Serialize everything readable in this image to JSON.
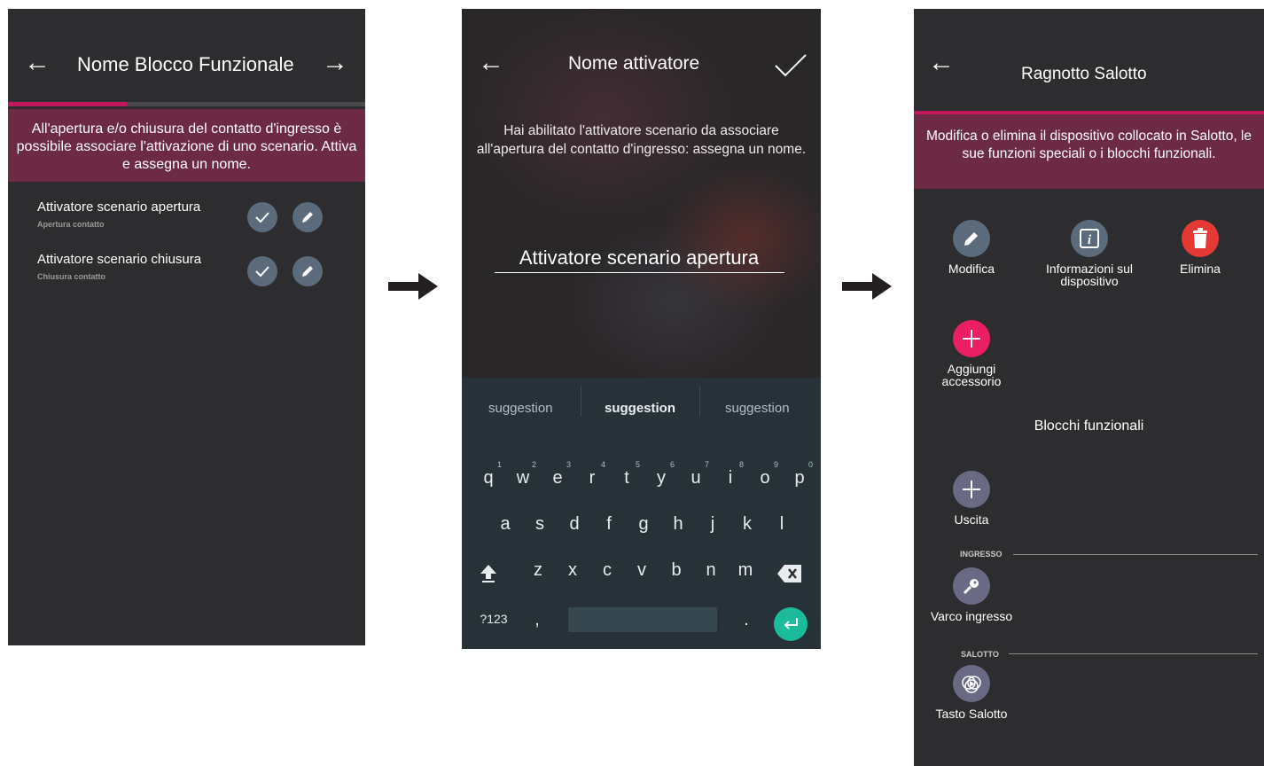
{
  "screen1": {
    "title": "Nome Blocco Funzionale",
    "banner": "All'apertura e/o chiusura del contatto d'ingresso è possibile associare l'attivazione di uno scenario. Attiva e assegna un nome.",
    "progress_fraction": 0.33,
    "rows": [
      {
        "title": "Attivatore scenario apertura",
        "subtitle": "Apertura contatto"
      },
      {
        "title": "Attivatore scenario chiusura",
        "subtitle": "Chiusura contatto"
      }
    ]
  },
  "screen2": {
    "title": "Nome attivatore",
    "description": "Hai abilitato l'attivatore scenario da associare all'apertura del contatto d'ingresso: assegna un nome.",
    "input_value": "Attivatore scenario apertura",
    "suggestions": [
      "suggestion",
      "suggestion",
      "suggestion"
    ],
    "keyboard": {
      "row1": [
        "q",
        "w",
        "e",
        "r",
        "t",
        "y",
        "u",
        "i",
        "o",
        "p"
      ],
      "row1_digits": [
        "1",
        "2",
        "3",
        "4",
        "5",
        "6",
        "7",
        "8",
        "9",
        "0"
      ],
      "row2": [
        "a",
        "s",
        "d",
        "f",
        "g",
        "h",
        "j",
        "k",
        "l"
      ],
      "row3": [
        "z",
        "x",
        "c",
        "v",
        "b",
        "n",
        "m"
      ],
      "symbols_key": "?123",
      "comma_key": ",",
      "period_key": "."
    }
  },
  "screen3": {
    "title": "Ragnotto Salotto",
    "banner": "Modifica o elimina il dispositivo collocato in Salotto, le sue funzioni speciali o i blocchi funzionali.",
    "actions": [
      {
        "label": "Modifica",
        "icon": "pencil-icon",
        "color": "#5b6b7c"
      },
      {
        "label": "Informazioni sul dispositivo",
        "icon": "info-icon",
        "color": "#5b6b7c"
      },
      {
        "label": "Elimina",
        "icon": "trash-icon",
        "color": "#e53935"
      },
      {
        "label": "Aggiungi accessorio",
        "icon": "plus-icon",
        "color": "#e91e63"
      }
    ],
    "section_title": "Blocchi funzionali",
    "blocks": [
      {
        "label": "Uscita",
        "icon": "plus-icon"
      }
    ],
    "groups": [
      {
        "label": "INGRESSO",
        "items": [
          {
            "label": "Varco ingresso",
            "icon": "key-icon"
          }
        ]
      },
      {
        "label": "SALOTTO",
        "items": [
          {
            "label": "Tasto Salotto",
            "icon": "scenario-icon"
          }
        ]
      }
    ]
  },
  "colors": {
    "accent": "#c2185b",
    "banner": "#6d2a45",
    "screen_bg": "#2d2d2f",
    "icon_bg": "#5b6b7c",
    "block_icon_bg": "#6b6a85",
    "enter_key": "#1bbc9b"
  }
}
